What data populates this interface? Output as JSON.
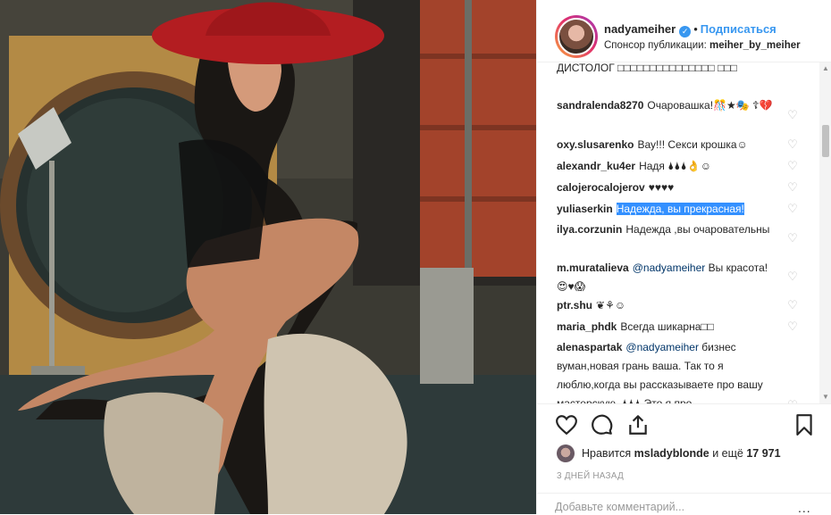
{
  "post": {
    "username": "nadyameiher",
    "separator": "•",
    "follow_label": "Подписаться",
    "sponsor_prefix": "Спонсор публикации:",
    "sponsor_name": "meiher_by_meiher",
    "verified_glyph": "✓"
  },
  "comments": [
    {
      "user": "",
      "text": "ДИСТОЛОГ □□□□□□□□□□□□□□□ □□□",
      "liked_icon": false
    },
    {
      "user": "sandralenda8270",
      "text": "Очаровашка!🎊★🎭 ☦💔",
      "liked_icon": true
    },
    {
      "user": "oxy.slusarenko",
      "text": "Вау!!! Секси крошка☺",
      "liked_icon": true
    },
    {
      "user": "alexandr_ku4er",
      "text": "Надя 🌢🌢🌢👌☺",
      "liked_icon": true
    },
    {
      "user": "calojerocalojerov",
      "text": "♥♥♥♥",
      "liked_icon": true
    },
    {
      "user": "yuliaserkin",
      "text": "Надежда, вы прекрасная!",
      "liked_icon": true
    },
    {
      "user": "ilya.corzunin",
      "text": "Надежда ,вы очаровательны",
      "liked_icon": true
    },
    {
      "user": "m.muratalieva",
      "mention": "@nadyameiher",
      "text": "Вы красота! 😍♥😱",
      "liked_icon": true
    },
    {
      "user": "ptr.shu",
      "text": "❦⚘☺",
      "liked_icon": true
    },
    {
      "user": "maria_phdk",
      "text": "Всегда шикарна□□",
      "liked_icon": true
    },
    {
      "user": "alenaspartak",
      "mention": "@nadyameiher",
      "text": "бизнес вуман,новая грань ваша. Так то я люблю,когда вы рассказываете про вашу мастерскую. 🌢🌢🌢 Это я про",
      "liked_icon": true
    }
  ],
  "likes": {
    "prefix": "Нравится",
    "user": "msladyblonde",
    "middle": "и ещё",
    "count": "17 971"
  },
  "timestamp": "3 ДНЕЙ НАЗАД",
  "add_comment": {
    "placeholder": "Добавьте комментарий...",
    "more": "..."
  },
  "icons": {
    "like": "heart-icon",
    "comment": "comment-icon",
    "share": "share-icon",
    "save": "bookmark-icon"
  }
}
